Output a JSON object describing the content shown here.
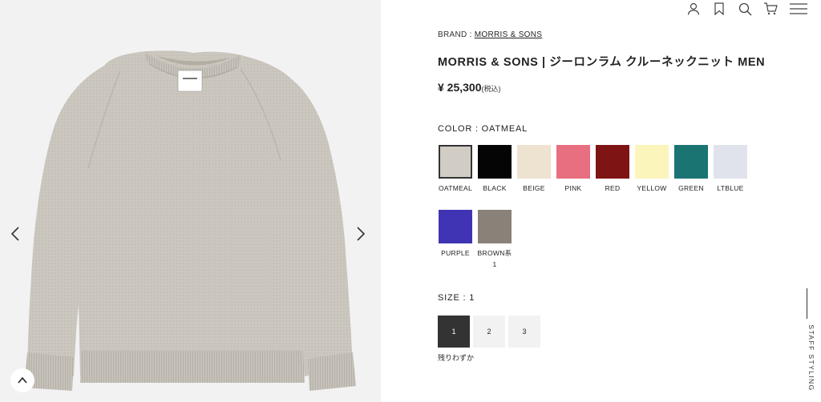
{
  "header": {
    "icons": [
      "user-icon",
      "bookmark-icon",
      "search-icon",
      "cart-icon",
      "menu-icon"
    ]
  },
  "gallery": {
    "image_alt": "MORRIS & SONS oatmeal crew neck knit",
    "prev_icon": "chevron-left-icon",
    "next_icon": "chevron-right-icon",
    "scroll_top_icon": "chevron-up-icon"
  },
  "product": {
    "brand_prefix": "BRAND :",
    "brand_name": "MORRIS & SONS",
    "title": "MORRIS & SONS | ジーロンラム クルーネックニット MEN",
    "price": "¥ 25,300",
    "tax_note": "(税込)"
  },
  "color": {
    "label": "COLOR : OATMEAL",
    "options": [
      {
        "name": "OATMEAL",
        "hex": "#d2cdc4",
        "selected": true
      },
      {
        "name": "BLACK",
        "hex": "#050505",
        "selected": false
      },
      {
        "name": "BEIGE",
        "hex": "#eee3d0",
        "selected": false
      },
      {
        "name": "PINK",
        "hex": "#e86f80",
        "selected": false
      },
      {
        "name": "RED",
        "hex": "#7f1414",
        "selected": false
      },
      {
        "name": "YELLOW",
        "hex": "#fbf5bc",
        "selected": false
      },
      {
        "name": "GREEN",
        "hex": "#1a7572",
        "selected": false
      },
      {
        "name": "LTBLUE",
        "hex": "#e1e3ec",
        "selected": false
      },
      {
        "name": "PURPLE",
        "hex": "#4134b4",
        "selected": false
      },
      {
        "name": "BROWN系1",
        "hex": "#8a8178",
        "selected": false
      }
    ]
  },
  "size": {
    "label": "SIZE : 1",
    "options": [
      {
        "label": "1",
        "selected": true
      },
      {
        "label": "2",
        "selected": false
      },
      {
        "label": "3",
        "selected": false
      }
    ],
    "stock_note": "残りわずか"
  },
  "side_tab": {
    "label": "STAFF STYLING"
  }
}
